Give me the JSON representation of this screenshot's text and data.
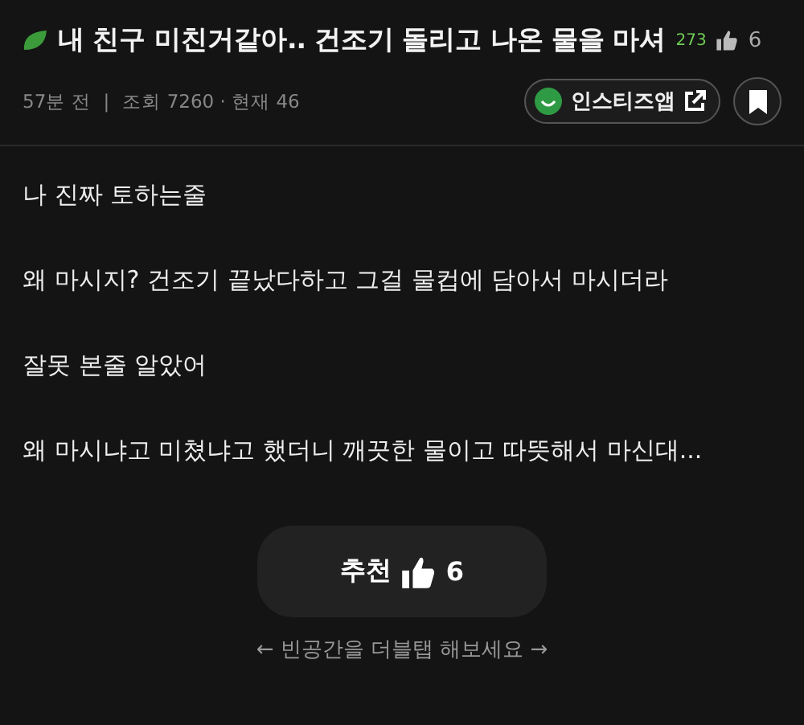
{
  "post": {
    "title": "내 친구 미친거같아.. 건조기 돌리고 나온 물을 마셔",
    "comment_count": "273",
    "like_count": "6",
    "time": "57분 전",
    "separator": "|",
    "views": "조회 7260 · 현재 46",
    "app_link": "인스티즈앱"
  },
  "body": [
    "나 진짜 토하는줄",
    "왜 마시지? 건조기 끝났다하고 그걸 물컵에 담아서 마시더라",
    "잘못 본줄 알았어",
    "왜 마시냐고 미쳤냐고 했더니 깨끗한 물이고 따뜻해서 마신대..."
  ],
  "recommend": {
    "label": "추천",
    "count": "6"
  },
  "hint": "← 빈공간을 더블탭 해보세요 →"
}
